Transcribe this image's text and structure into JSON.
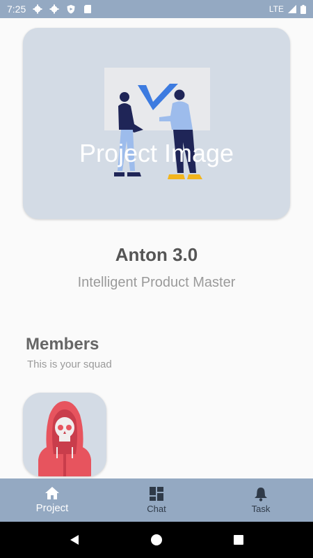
{
  "status_bar": {
    "time": "7:25",
    "network": "LTE"
  },
  "project": {
    "image_label": "Project Image",
    "name": "Anton 3.0",
    "tagline": "Intelligent Product Master"
  },
  "members": {
    "title": "Members",
    "subtitle": "This is your squad",
    "list": [
      {
        "avatar": "hooded-skull-avatar"
      }
    ]
  },
  "bottom_nav": {
    "items": [
      {
        "label": "Project",
        "icon": "home-icon",
        "active": true
      },
      {
        "label": "Chat",
        "icon": "dashboard-icon",
        "active": false
      },
      {
        "label": "Task",
        "icon": "bell-icon",
        "active": false
      }
    ]
  },
  "colors": {
    "accent": "#94a9c2",
    "card": "#d3dbe5",
    "background": "#fafafa"
  }
}
